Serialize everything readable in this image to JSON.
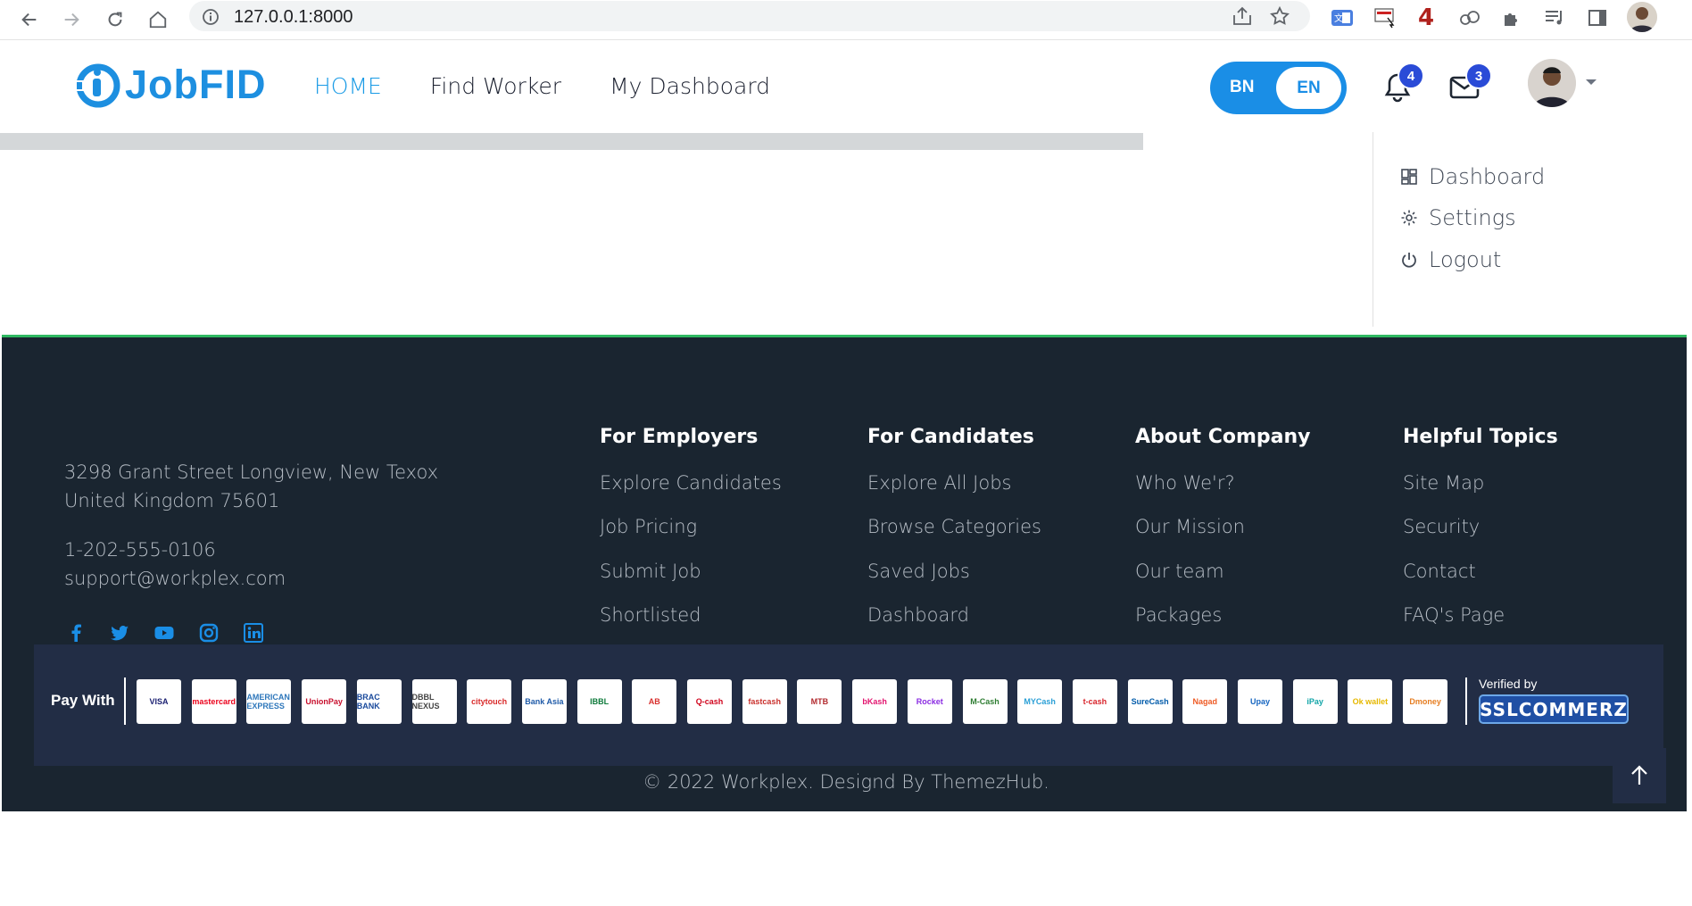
{
  "browser": {
    "url": "127.0.0.1:8000",
    "ext_badge_count": "4"
  },
  "header": {
    "logo_text": "JobFID",
    "nav": [
      "HOME",
      "Find Worker",
      "My Dashboard"
    ],
    "active_nav": "HOME",
    "lang_bn": "BN",
    "lang_en": "EN",
    "notifications_count": "4",
    "messages_count": "3"
  },
  "dropdown": {
    "items": [
      "Dashboard",
      "Settings",
      "Logout"
    ]
  },
  "footer": {
    "address_line1": "3298 Grant Street Longview, New Texox",
    "address_line2": "United Kingdom 75601",
    "phone": "1-202-555-0106",
    "email": "support@workplex.com",
    "social": [
      "facebook-icon",
      "twitter-icon",
      "youtube-icon",
      "instagram-icon",
      "linkedin-icon"
    ],
    "columns": [
      {
        "title": "For Employers",
        "links": [
          "Explore Candidates",
          "Job Pricing",
          "Submit Job",
          "Shortlisted"
        ]
      },
      {
        "title": "For Candidates",
        "links": [
          "Explore All Jobs",
          "Browse Categories",
          "Saved Jobs",
          "Dashboard"
        ]
      },
      {
        "title": "About Company",
        "links": [
          "Who We'r?",
          "Our Mission",
          "Our team",
          "Packages"
        ]
      },
      {
        "title": "Helpful Topics",
        "links": [
          "Site Map",
          "Security",
          "Contact",
          "FAQ's Page"
        ]
      }
    ],
    "pay_with": "Pay With",
    "payment_logos": [
      "VISA",
      "mastercard",
      "AMERICAN EXPRESS",
      "UnionPay",
      "BRAC BANK",
      "DBBL NEXUS",
      "citytouch",
      "Bank Asia",
      "IBBL",
      "AB",
      "Q-cash",
      "fastcash",
      "MTB",
      "bKash",
      "Rocket",
      "M-Cash",
      "MYCash",
      "t-cash",
      "SureCash",
      "Nagad",
      "Upay",
      "iPay",
      "Ok wallet",
      "Dmoney"
    ],
    "verified_by": "Verified by",
    "sslcommerz": "SSLCOMMERZ",
    "copyright": "© 2022 Workplex. Designd By ThemezHub."
  }
}
